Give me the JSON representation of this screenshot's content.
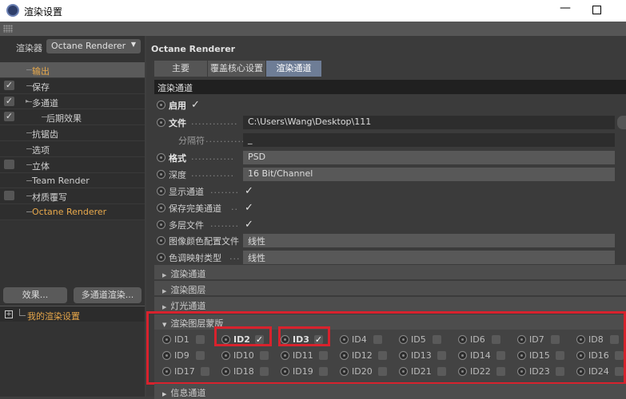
{
  "window": {
    "title": "渲染设置"
  },
  "left": {
    "renderer_label": "渲染器",
    "renderer_value": "Octane Renderer",
    "tree": [
      {
        "label": "输出",
        "checked": false,
        "has_check": false,
        "selected": true,
        "color": "#e8a94c"
      },
      {
        "label": "保存",
        "checked": true,
        "has_check": true,
        "selected": false,
        "color": "#d0d0d0"
      },
      {
        "label": "多通道",
        "checked": true,
        "has_check": true,
        "selected": false,
        "color": "#d0d0d0"
      },
      {
        "label": "后期效果",
        "checked": true,
        "has_check": true,
        "selected": false,
        "color": "#d0d0d0"
      },
      {
        "label": "抗锯齿",
        "checked": false,
        "has_check": false,
        "selected": false,
        "color": "#d0d0d0"
      },
      {
        "label": "选项",
        "checked": false,
        "has_check": false,
        "selected": false,
        "color": "#d0d0d0"
      },
      {
        "label": "立体",
        "checked": false,
        "has_check": true,
        "selected": false,
        "color": "#d0d0d0"
      },
      {
        "label": "Team Render",
        "checked": false,
        "has_check": false,
        "selected": false,
        "color": "#d0d0d0"
      },
      {
        "label": "材质覆写",
        "checked": false,
        "has_check": true,
        "selected": false,
        "color": "#d0d0d0"
      },
      {
        "label": "Octane Renderer",
        "checked": false,
        "has_check": false,
        "selected": false,
        "color": "#e8a94c"
      }
    ],
    "effects_button": "效果...",
    "multipass_button": "多通道渲染...",
    "preset_label": "我的渲染设置"
  },
  "right": {
    "title": "Octane Renderer",
    "tabs": [
      "主要",
      "覆盖核心设置",
      "渲染通道"
    ],
    "section_header": "渲染通道",
    "enable_label": "启用",
    "file_label": "文件",
    "file_dots": ".............",
    "file_value": "C:\\Users\\Wang\\Desktop\\111",
    "separator_label": "分隔符",
    "separator_dots": "...........",
    "separator_value": "_",
    "format_label": "格式",
    "format_dots": "............",
    "format_value": "PSD",
    "depth_label": "深度",
    "depth_dots": "............",
    "depth_value": "16 Bit/Channel",
    "show_pass_label": "显示通道",
    "show_pass_dots": "........",
    "save_beauty_label": "保存完美通道",
    "save_beauty_dots": "..",
    "multilayer_label": "多层文件",
    "multilayer_dots": "........",
    "color_profile_label": "图像颜色配置文件",
    "color_profile_value": "线性",
    "tonemap_label": "色调映射类型",
    "tonemap_dots": "...",
    "tonemap_value": "线性",
    "collapsed_groups": [
      "渲染通道",
      "渲染图层",
      "灯光通道"
    ],
    "mask_group": "渲染图层蒙版",
    "ids": [
      {
        "label": "ID1",
        "checked": false
      },
      {
        "label": "ID2",
        "checked": true
      },
      {
        "label": "ID3",
        "checked": true
      },
      {
        "label": "ID4",
        "checked": false
      },
      {
        "label": "ID5",
        "checked": false
      },
      {
        "label": "ID6",
        "checked": false
      },
      {
        "label": "ID7",
        "checked": false
      },
      {
        "label": "ID8",
        "checked": false
      },
      {
        "label": "ID9",
        "checked": false
      },
      {
        "label": "ID10",
        "checked": false
      },
      {
        "label": "ID11",
        "checked": false
      },
      {
        "label": "ID12",
        "checked": false
      },
      {
        "label": "ID13",
        "checked": false
      },
      {
        "label": "ID14",
        "checked": false
      },
      {
        "label": "ID15",
        "checked": false
      },
      {
        "label": "ID16",
        "checked": false
      },
      {
        "label": "ID17",
        "checked": false
      },
      {
        "label": "ID18",
        "checked": false
      },
      {
        "label": "ID19",
        "checked": false
      },
      {
        "label": "ID20",
        "checked": false
      },
      {
        "label": "ID21",
        "checked": false
      },
      {
        "label": "ID22",
        "checked": false
      },
      {
        "label": "ID23",
        "checked": false
      },
      {
        "label": "ID24",
        "checked": false
      }
    ],
    "info_group": "信息通道"
  },
  "colors": {
    "accent_orange": "#e8a94c",
    "highlight_red": "#d8222d",
    "active_tab": "#6e7d96"
  }
}
